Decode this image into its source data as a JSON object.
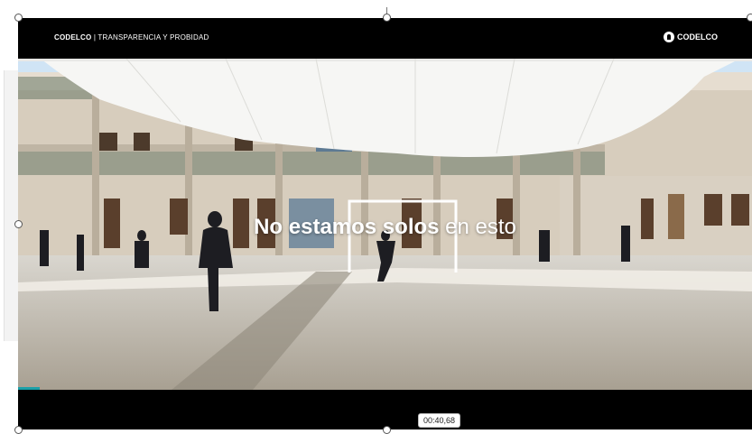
{
  "header": {
    "brand": "CODELCO",
    "separator": "|",
    "subtitle": "TRANSPARENCIA Y PROBIDAD",
    "logo_text": "CODELCO"
  },
  "video": {
    "title_bold": "No estamos solos",
    "title_light": "en esto",
    "progress": 0.03
  },
  "overlay": {
    "timestamp": "00:40,68"
  },
  "colors": {
    "accent": "#1ba0a8",
    "bar": "#000000"
  }
}
